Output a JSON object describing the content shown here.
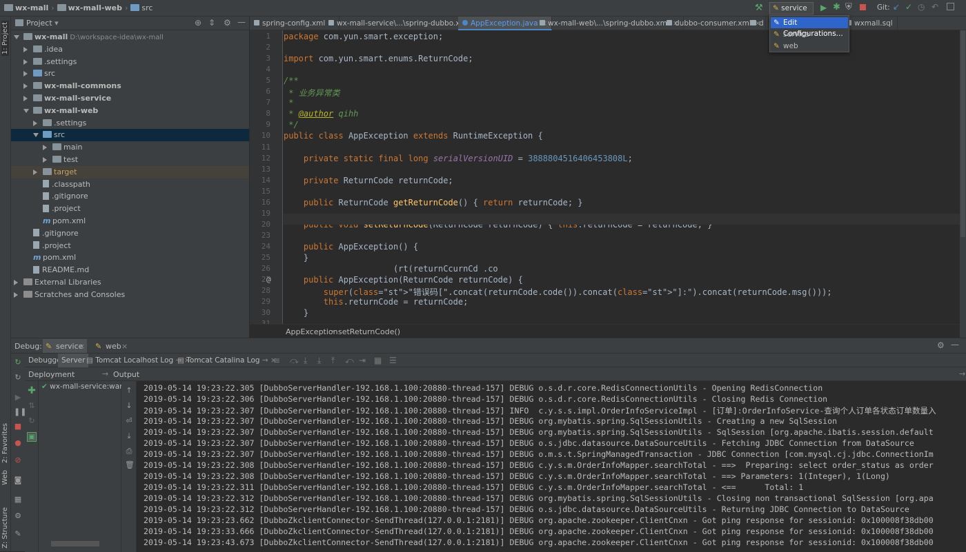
{
  "breadcrumb": {
    "items": [
      "wx-mall",
      "wx-mall-web",
      "src"
    ]
  },
  "run_config": {
    "selected": "service",
    "options": [
      "Edit Configurations...",
      "service",
      "web"
    ],
    "git_label": "Git:"
  },
  "left_stripe": {
    "project": "1: Project",
    "favorites": "2: Favorites",
    "web": "Web",
    "structure": "Z: Structure"
  },
  "project": {
    "title": "Project",
    "tree": [
      {
        "label": "wx-mall",
        "extra": "D:\\workspace-idea\\wx-mall",
        "depth": 0,
        "open": true,
        "bold": true,
        "icon": "folder-icon"
      },
      {
        "label": ".idea",
        "depth": 1,
        "open": false,
        "icon": "folder-icon"
      },
      {
        "label": ".settings",
        "depth": 1,
        "open": false,
        "icon": "folder-icon"
      },
      {
        "label": "src",
        "depth": 1,
        "open": false,
        "icon": "folder-icon"
      },
      {
        "label": "wx-mall-commons",
        "depth": 1,
        "open": false,
        "bold": true,
        "icon": "module-icon"
      },
      {
        "label": "wx-mall-service",
        "depth": 1,
        "open": false,
        "bold": true,
        "icon": "module-icon"
      },
      {
        "label": "wx-mall-web",
        "depth": 1,
        "open": true,
        "bold": true,
        "icon": "module-icon"
      },
      {
        "label": ".settings",
        "depth": 2,
        "open": false,
        "icon": "folder-icon"
      },
      {
        "label": "src",
        "depth": 2,
        "open": true,
        "selected": true,
        "icon": "folder-icon"
      },
      {
        "label": "main",
        "depth": 3,
        "open": false,
        "icon": "folder-icon"
      },
      {
        "label": "test",
        "depth": 3,
        "open": false,
        "icon": "folder-icon"
      },
      {
        "label": "target",
        "depth": 2,
        "open": false,
        "highlight": true,
        "icon": "folder-icon"
      },
      {
        "label": ".classpath",
        "depth": 2,
        "leaf": true,
        "icon": "file-icon"
      },
      {
        "label": ".gitignore",
        "depth": 2,
        "leaf": true,
        "icon": "file-icon"
      },
      {
        "label": ".project",
        "depth": 2,
        "leaf": true,
        "icon": "file-icon"
      },
      {
        "label": "pom.xml",
        "depth": 2,
        "leaf": true,
        "icon": "maven-icon"
      },
      {
        "label": ".gitignore",
        "depth": 1,
        "leaf": true,
        "icon": "file-icon"
      },
      {
        "label": ".project",
        "depth": 1,
        "leaf": true,
        "icon": "file-icon"
      },
      {
        "label": "pom.xml",
        "depth": 1,
        "leaf": true,
        "icon": "maven-icon"
      },
      {
        "label": "README.md",
        "depth": 1,
        "leaf": true,
        "icon": "file-icon"
      },
      {
        "label": "External Libraries",
        "depth": 0,
        "open": false,
        "icon": "library-icon"
      },
      {
        "label": "Scratches and Consoles",
        "depth": 0,
        "open": false,
        "icon": "scratch-icon"
      }
    ]
  },
  "editor": {
    "tabs": [
      {
        "label": "spring-config.xml",
        "active": false
      },
      {
        "label": "wx-mall-service\\...\\spring-dubbo.xml",
        "active": false
      },
      {
        "label": "AppException.java",
        "active": true
      },
      {
        "label": "wx-mall-web\\...\\spring-dubbo.xml",
        "active": false
      },
      {
        "label": "dubbo-consumer.xml",
        "active": false
      },
      {
        "label": "d",
        "active": false
      },
      {
        "label": "wxmall.sql",
        "active": false
      }
    ],
    "line_numbers": [
      "1",
      "2",
      "3",
      "4",
      "5",
      "6",
      "7",
      "8",
      "9",
      "10",
      "11",
      "12",
      "13",
      "14",
      "15",
      "16",
      "19",
      "20",
      "23",
      "24",
      "25",
      "26",
      "27",
      "28",
      "29",
      "30",
      "31"
    ],
    "code_lines": [
      "package com.yun.smart.exception;",
      "",
      "import com.yun.smart.enums.ReturnCode;",
      "",
      "/**",
      " * 业务异常类",
      " *",
      " * @author qihh",
      " */",
      "public class AppException extends RuntimeException {",
      "",
      "    private static final long serialVersionUID = 3888804516406453808L;",
      "",
      "    private ReturnCode returnCode;",
      "",
      "    public ReturnCode getReturnCode() { return returnCode; }",
      "",
      "    public void setReturnCode(ReturnCode returnCode) { this.returnCode = returnCode; }",
      "",
      "    public AppException() {",
      "    }",
      "                      (rt(returnCcurnCd .co",
      "    public AppException(ReturnCode returnCode) {",
      "        super(\"错误码[\".concat(returnCode.code()).concat(\"]:\").concat(returnCode.msg()));",
      "        this.returnCode = returnCode;",
      "    }",
      ""
    ],
    "breadcrumb": [
      "AppException",
      "setReturnCode()"
    ]
  },
  "debug": {
    "label": "Debug:",
    "sessions": [
      "service",
      "web"
    ],
    "tabs": [
      "Debugger",
      "Server",
      "Tomcat Localhost Log",
      "Tomcat Catalina Log"
    ],
    "deployment_label": "Deployment",
    "output_label": "Output",
    "artifact": "wx-mall-service:war",
    "log": [
      "2019-05-14 19:23:22.305 [DubboServerHandler-192.168.1.100:20880-thread-157] DEBUG o.s.d.r.core.RedisConnectionUtils - Opening RedisConnection",
      "2019-05-14 19:23:22.306 [DubboServerHandler-192.168.1.100:20880-thread-157] DEBUG o.s.d.r.core.RedisConnectionUtils - Closing Redis Connection",
      "2019-05-14 19:23:22.307 [DubboServerHandler-192.168.1.100:20880-thread-157] INFO  c.y.s.s.impl.OrderInfoServiceImpl - [订单]:OrderInfoService-查询个人订单各状态订单数量入",
      "2019-05-14 19:23:22.307 [DubboServerHandler-192.168.1.100:20880-thread-157] DEBUG org.mybatis.spring.SqlSessionUtils - Creating a new SqlSession",
      "2019-05-14 19:23:22.307 [DubboServerHandler-192.168.1.100:20880-thread-157] DEBUG org.mybatis.spring.SqlSessionUtils - SqlSession [org.apache.ibatis.session.default",
      "2019-05-14 19:23:22.307 [DubboServerHandler-192.168.1.100:20880-thread-157] DEBUG o.s.jdbc.datasource.DataSourceUtils - Fetching JDBC Connection from DataSource",
      "2019-05-14 19:23:22.307 [DubboServerHandler-192.168.1.100:20880-thread-157] DEBUG o.m.s.t.SpringManagedTransaction - JDBC Connection [com.mysql.cj.jdbc.ConnectionIm",
      "2019-05-14 19:23:22.308 [DubboServerHandler-192.168.1.100:20880-thread-157] DEBUG c.y.s.m.OrderInfoMapper.searchTotal - ==>  Preparing: select order_status as order",
      "2019-05-14 19:23:22.308 [DubboServerHandler-192.168.1.100:20880-thread-157] DEBUG c.y.s.m.OrderInfoMapper.searchTotal - ==> Parameters: 1(Integer), 1(Long)",
      "2019-05-14 19:23:22.311 [DubboServerHandler-192.168.1.100:20880-thread-157] DEBUG c.y.s.m.OrderInfoMapper.searchTotal - <==      Total: 1",
      "2019-05-14 19:23:22.312 [DubboServerHandler-192.168.1.100:20880-thread-157] DEBUG org.mybatis.spring.SqlSessionUtils - Closing non transactional SqlSession [org.apa",
      "2019-05-14 19:23:22.312 [DubboServerHandler-192.168.1.100:20880-thread-157] DEBUG o.s.jdbc.datasource.DataSourceUtils - Returning JDBC Connection to DataSource",
      "2019-05-14 19:23:23.662 [DubboZkclientConnector-SendThread(127.0.0.1:2181)] DEBUG org.apache.zookeeper.ClientCnxn - Got ping response for sessionid: 0x100008f38db00",
      "2019-05-14 19:23:33.666 [DubboZkclientConnector-SendThread(127.0.0.1:2181)] DEBUG org.apache.zookeeper.ClientCnxn - Got ping response for sessionid: 0x100008f38db00",
      "2019-05-14 19:23:43.673 [DubboZkclientConnector-SendThread(127.0.0.1:2181)] DEBUG org.apache.zookeeper.ClientCnxn - Got ping response for sessionid: 0x100008f38db00"
    ]
  },
  "colors": {
    "accent": "#2f65ca",
    "selection": "#0d293e",
    "run": "#59a869",
    "stop": "#c75450"
  }
}
